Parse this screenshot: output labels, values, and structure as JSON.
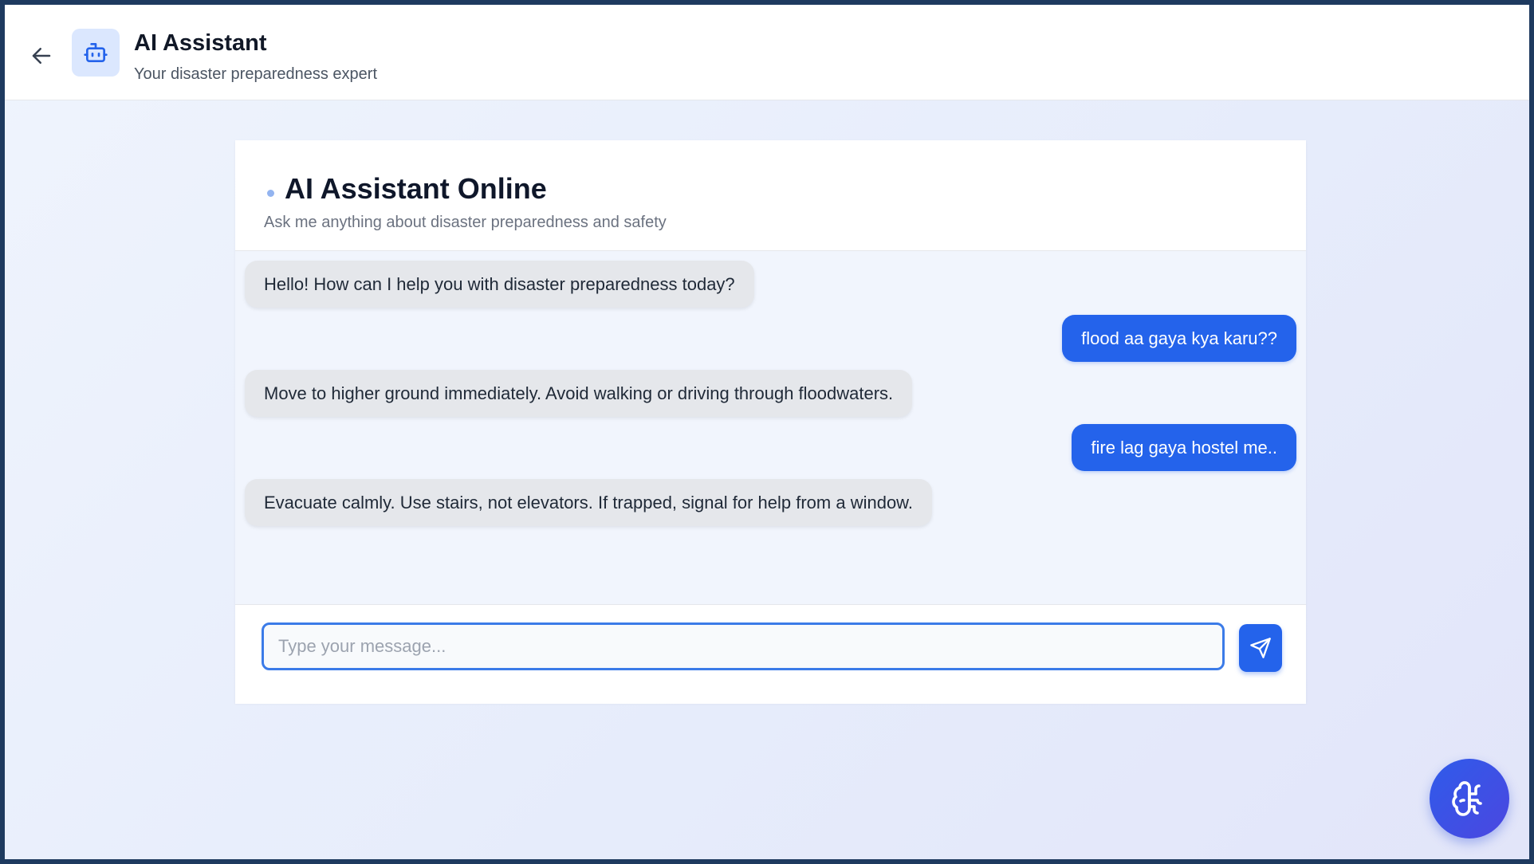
{
  "header": {
    "title": "AI Assistant",
    "subtitle": "Your disaster preparedness expert",
    "back_icon": "arrow-left-icon",
    "avatar_icon": "bot-icon"
  },
  "chat": {
    "title": "AI Assistant Online",
    "subtitle": "Ask me anything about disaster preparedness and safety",
    "messages": [
      {
        "role": "assistant",
        "text": "Hello! How can I help you with disaster preparedness today?"
      },
      {
        "role": "user",
        "text": "flood aa gaya kya karu??"
      },
      {
        "role": "assistant",
        "text": "Move to higher ground immediately. Avoid walking or driving through floodwaters."
      },
      {
        "role": "user",
        "text": "fire lag gaya hostel me.."
      },
      {
        "role": "assistant",
        "text": "Evacuate calmly. Use stairs, not elevators. If trapped, signal for help from a window."
      }
    ]
  },
  "composer": {
    "placeholder": "Type your message...",
    "value": "",
    "send_icon": "send-icon"
  },
  "fab": {
    "icon": "brain-icon"
  },
  "colors": {
    "accent": "#2463eb",
    "bot_bubble": "#e5e7eb",
    "status_dot": "#93b4f0",
    "frame_border": "#1e3a5f"
  }
}
